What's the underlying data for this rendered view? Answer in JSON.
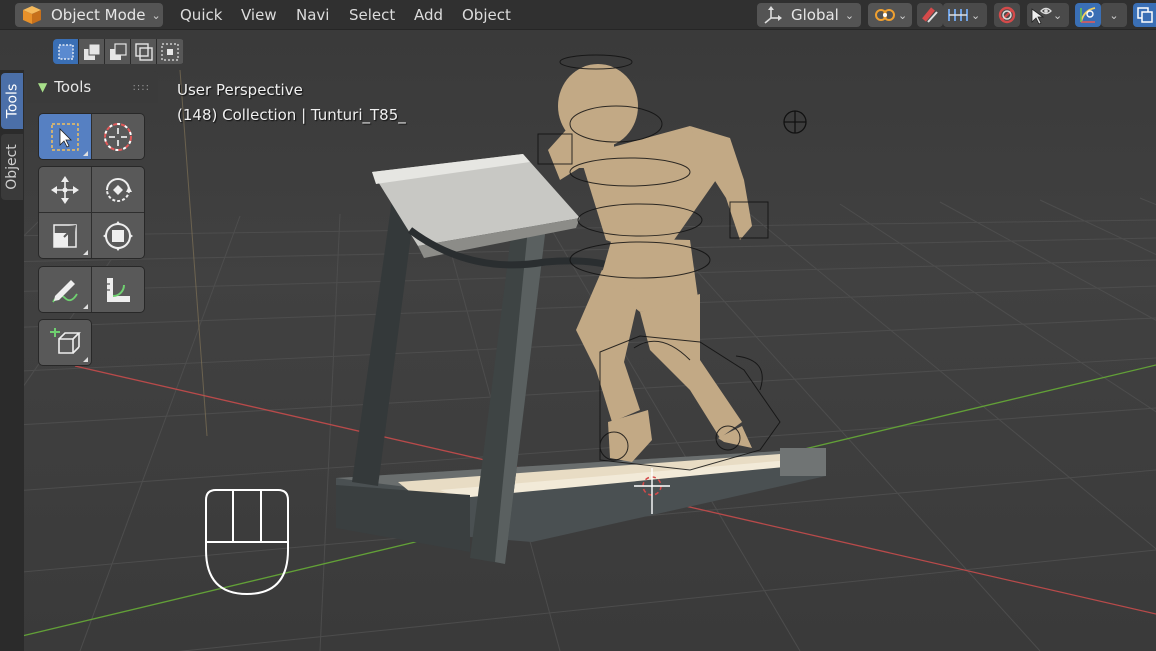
{
  "header": {
    "mode_label": "Object Mode",
    "menus": [
      "Quick",
      "View",
      "Navi",
      "Select",
      "Add",
      "Object"
    ],
    "orientation_label": "Global",
    "icons": {
      "mode": "cube-icon",
      "orientation": "transform-orientation-icon",
      "pivot": "pivot-point-icon",
      "snap": "magnet-snap-icon",
      "snap_increment": "snap-increment-icon",
      "proportional": "proportional-editing-icon",
      "visibility": "eye-cursor-icon",
      "gizmo": "gizmo-icon",
      "overlay": "overlay-icon"
    }
  },
  "select_modes": [
    "select-new-icon",
    "select-extend-icon",
    "select-subtract-icon",
    "select-difference-icon",
    "select-intersect-icon"
  ],
  "side_tabs": {
    "tools": "Tools",
    "object": "Object"
  },
  "tools_panel": {
    "title": "Tools",
    "icons": {
      "select": "select-box-icon",
      "cursor": "cursor-icon",
      "move": "move-icon",
      "rotate": "rotate-icon",
      "scale": "scale-icon",
      "transform": "transform-icon",
      "annotate": "annotate-icon",
      "measure": "measure-icon",
      "add_cube": "add-cube-icon"
    }
  },
  "viewport": {
    "perspective_label": "User Perspective",
    "collection_label": "(148) Collection | Tunturi_T85_",
    "mouse_icon": "mouse-icon"
  },
  "colors": {
    "header_bg": "#303030",
    "viewport_bg": "#3d3d3d",
    "active_tool": "#5680c2",
    "axis_x": "#b84a4a",
    "axis_y": "#62a037",
    "accent": "#3a6fb5",
    "body_color": "#c2a985"
  }
}
